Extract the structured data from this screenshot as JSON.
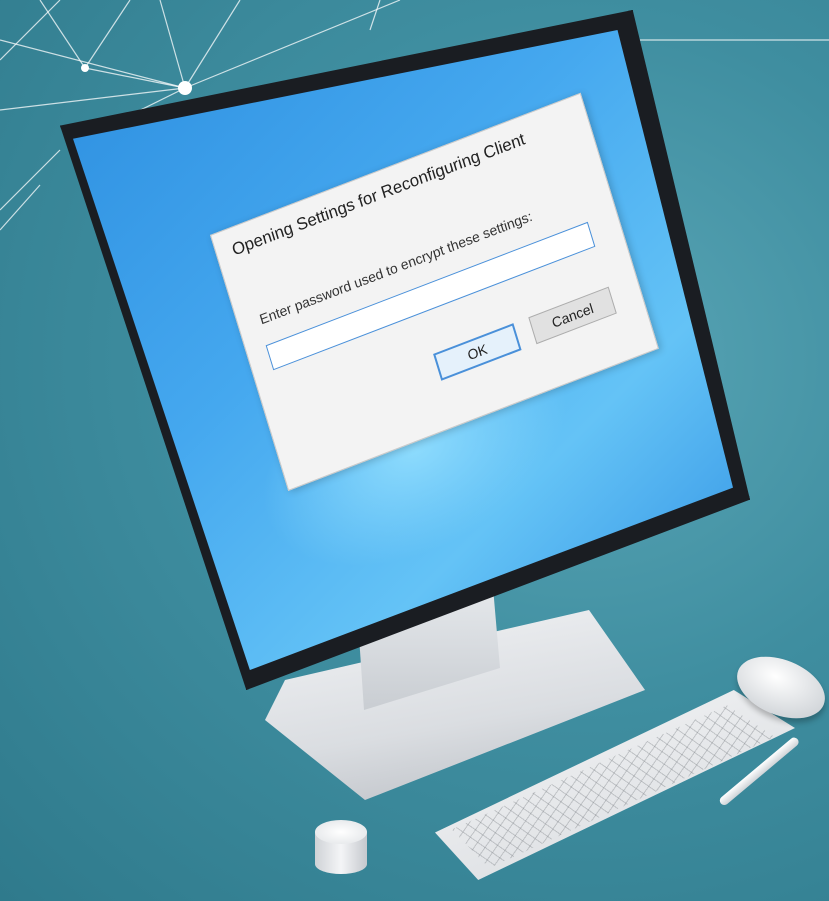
{
  "dialog": {
    "title": "Opening Settings for Reconfiguring Client",
    "prompt": "Enter password used to encrypt these settings:",
    "password_value": "",
    "ok_label": "OK",
    "cancel_label": "Cancel"
  },
  "colors": {
    "background": "#3f8ea0",
    "screen": "#45a8ef",
    "dialog": "#f3f3f3",
    "focus_border": "#4a90d9"
  },
  "icons": [
    "network-lines-decoration",
    "monitor",
    "keyboard",
    "mouse",
    "stylus-pen",
    "surface-dial"
  ]
}
